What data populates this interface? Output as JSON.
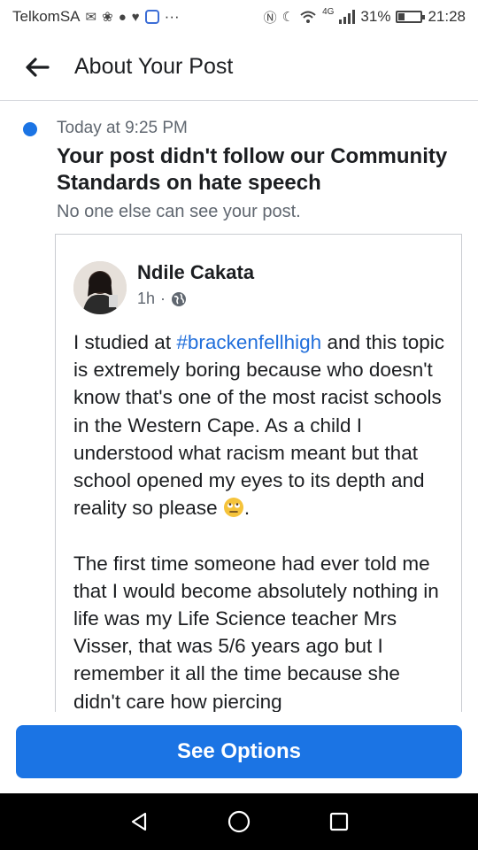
{
  "status_bar": {
    "carrier": "TelkomSA",
    "network": "4G",
    "battery": "31%",
    "battery_level": 0.31,
    "time": "21:28",
    "more": "···"
  },
  "header": {
    "title": "About Your Post"
  },
  "notice": {
    "timestamp": "Today at 9:25 PM",
    "title": "Your post didn't follow our Community Standards on hate speech",
    "subtitle": "No one else can see your post."
  },
  "post": {
    "author": "Ndile Cakata",
    "age": "1h",
    "separator": "·",
    "p1_before": "I studied at ",
    "hashtag": "#brackenfellhigh",
    "p1_after": " and this topic is extremely boring because who doesn't know that's one of the most racist schools in the Western Cape. As a child I understood what racism meant but that school opened my eyes to its depth and reality so please ",
    "p1_end": ".",
    "p2": "The first time someone had ever told me that I would become absolutely nothing in life was my Life Science teacher Mrs Visser, that was 5/6 years ago but I remember it all the time because she didn't care how piercing"
  },
  "actions": {
    "see_options": "See Options"
  },
  "colors": {
    "accent": "#1b74e4",
    "hashtag": "#216fdb",
    "secondary_text": "#606770"
  }
}
